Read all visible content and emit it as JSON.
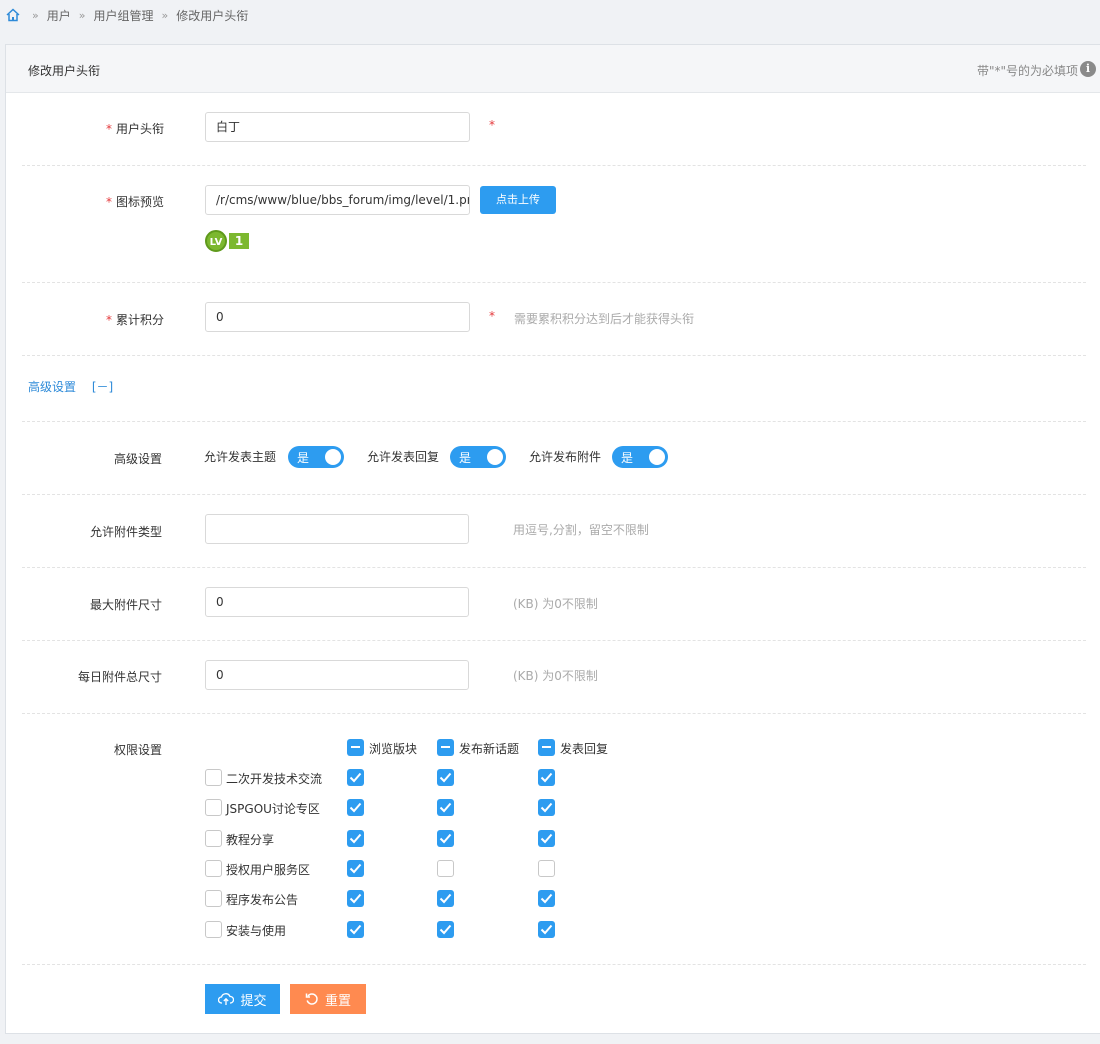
{
  "breadcrumb": {
    "items": [
      "用户",
      "用户组管理",
      "修改用户头衔"
    ],
    "separator": "»"
  },
  "panel": {
    "title": "修改用户头衔",
    "note": "带\"*\"号的为必填项"
  },
  "form": {
    "title_field": {
      "label": "用户头衔",
      "value": "白丁",
      "star": "*"
    },
    "icon_field": {
      "label": "图标预览",
      "value": "/r/cms/www/blue/bbs_forum/img/level/1.pr",
      "upload_label": "点击上传",
      "badge_lv": "LV",
      "badge_num": "1"
    },
    "points_field": {
      "label": "累计积分",
      "value": "0",
      "star": "*",
      "hint": "需要累积积分达到后才能获得头衔"
    },
    "advanced_toggle": {
      "label": "高级设置",
      "control": "[－]"
    },
    "advanced": {
      "label": "高级设置",
      "switches": [
        {
          "label": "允许发表主题",
          "state": "是"
        },
        {
          "label": "允许发表回复",
          "state": "是"
        },
        {
          "label": "允许发布附件",
          "state": "是"
        }
      ]
    },
    "attach_types": {
      "label": "允许附件类型",
      "value": "",
      "hint": "用逗号,分割，留空不限制"
    },
    "max_attach": {
      "label": "最大附件尺寸",
      "value": "0",
      "hint": "(KB) 为0不限制"
    },
    "daily_attach": {
      "label": "每日附件总尺寸",
      "value": "0",
      "hint": "(KB) 为0不限制"
    },
    "permissions": {
      "label": "权限设置",
      "columns": [
        "浏览版块",
        "发布新话题",
        "发表回复"
      ],
      "rows": [
        {
          "name": "二次开发技术交流",
          "values": [
            true,
            true,
            true
          ]
        },
        {
          "name": "JSPGOU讨论专区",
          "values": [
            true,
            true,
            true
          ]
        },
        {
          "name": "教程分享",
          "values": [
            true,
            true,
            true
          ]
        },
        {
          "name": "授权用户服务区",
          "values": [
            true,
            false,
            false
          ]
        },
        {
          "name": "程序发布公告",
          "values": [
            true,
            true,
            true
          ]
        },
        {
          "name": "安装与使用",
          "values": [
            true,
            true,
            true
          ]
        }
      ]
    },
    "buttons": {
      "submit": "提交",
      "reset": "重置"
    }
  },
  "colors": {
    "accent": "#2d9cf0",
    "reset": "#ff8a50",
    "required": "#e4393c",
    "badge": "#7cb82f"
  }
}
